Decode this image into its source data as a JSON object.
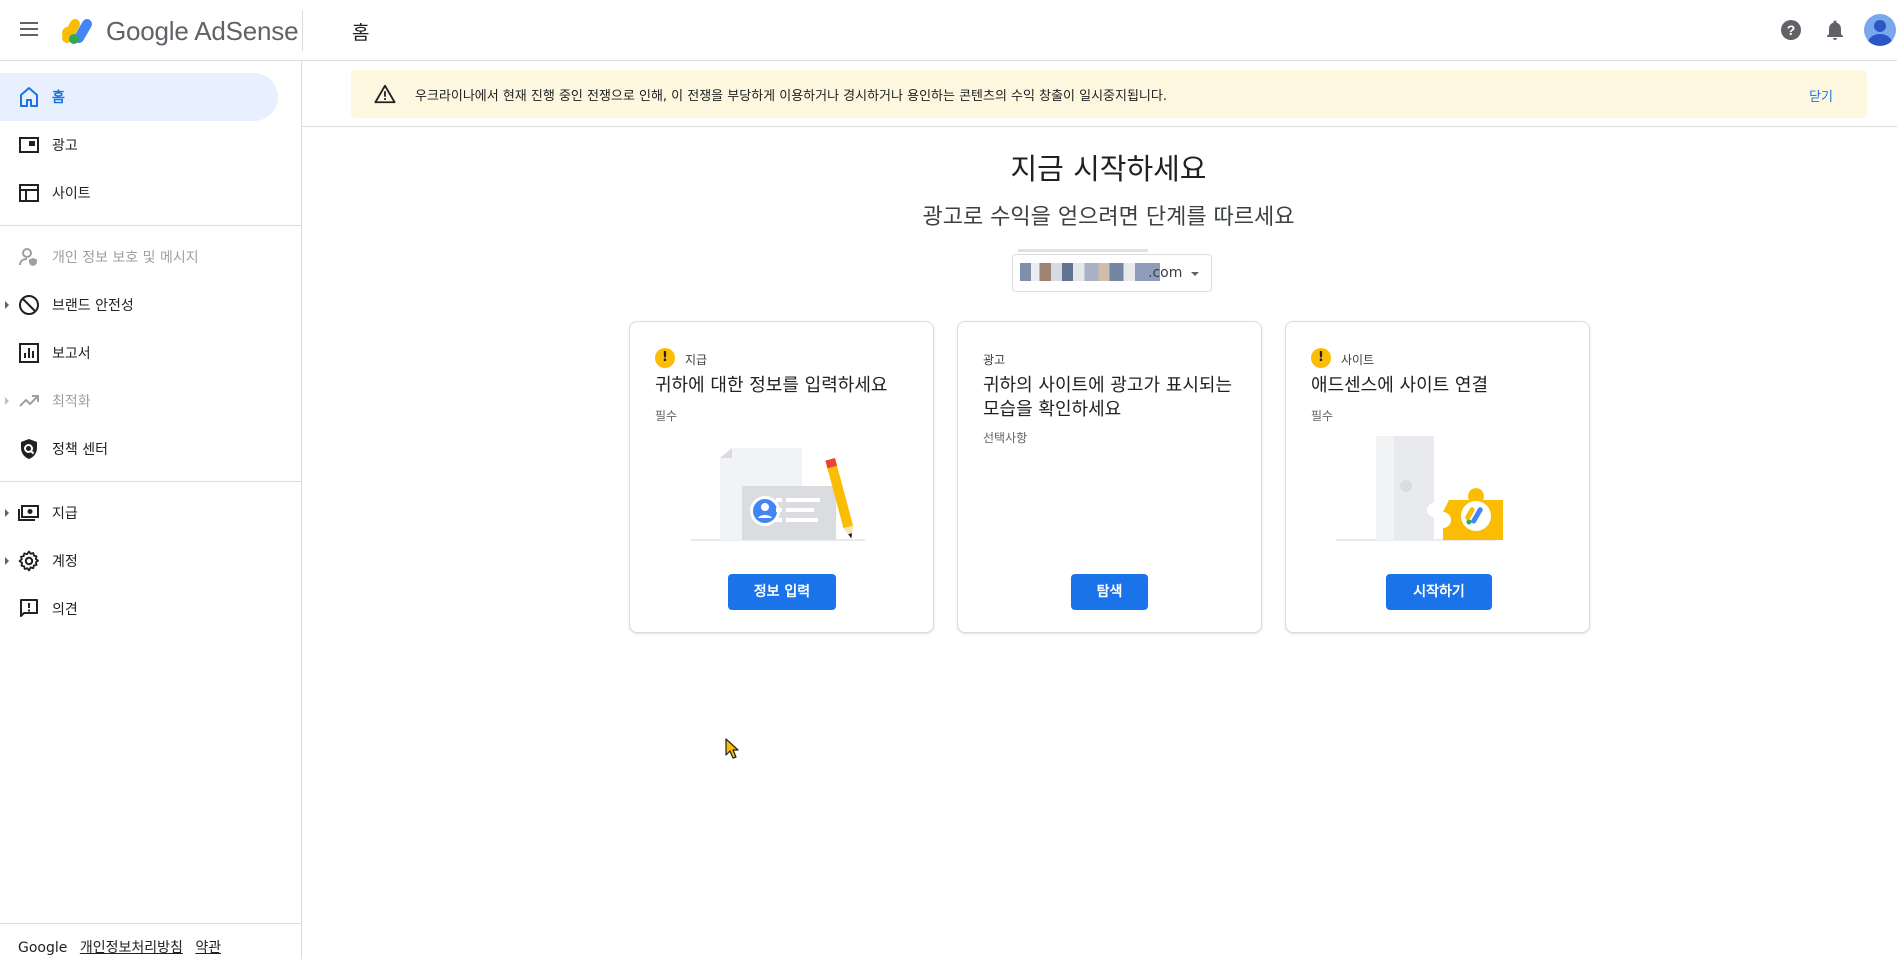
{
  "header": {
    "brand": "Google AdSense",
    "page_title": "홈"
  },
  "sidebar": {
    "items": [
      {
        "label": "홈",
        "icon": "home-icon",
        "state": "active"
      },
      {
        "label": "광고",
        "icon": "ads-icon",
        "state": "normal"
      },
      {
        "label": "사이트",
        "icon": "sites-icon",
        "state": "normal"
      },
      {
        "label": "개인 정보 보호 및 메시지",
        "icon": "privacy-icon",
        "state": "disabled"
      },
      {
        "label": "브랜드 안전성",
        "icon": "block-icon",
        "state": "normal"
      },
      {
        "label": "보고서",
        "icon": "reports-icon",
        "state": "normal"
      },
      {
        "label": "최적화",
        "icon": "trending-icon",
        "state": "disabled"
      },
      {
        "label": "정책 센터",
        "icon": "policy-icon",
        "state": "normal"
      },
      {
        "label": "지급",
        "icon": "payments-icon",
        "state": "normal"
      },
      {
        "label": "계정",
        "icon": "gear-icon",
        "state": "normal"
      },
      {
        "label": "의견",
        "icon": "feedback-icon",
        "state": "normal"
      }
    ],
    "footer": {
      "brand": "Google",
      "privacy": "개인정보처리방침",
      "terms": "약관"
    }
  },
  "banner": {
    "message": "우크라이나에서 현재 진행 중인 전쟁으로 인해, 이 전쟁을 부당하게 이용하거나 경시하거나 용인하는 콘텐츠의 수익 창출이 일시중지됩니다.",
    "close": "닫기"
  },
  "main": {
    "title": "지금 시작하세요",
    "subtitle": "광고로 수익을 얻으려면 단계를 따르세요",
    "site_select": {
      "suffix": ".com"
    },
    "cards": [
      {
        "category": "지급",
        "title": "귀하에 대한 정보를 입력하세요",
        "requirement": "필수",
        "button": "정보 입력",
        "has_warning": true
      },
      {
        "category": "광고",
        "title": "귀하의 사이트에 광고가 표시되는 모습을 확인하세요",
        "requirement": "선택사항",
        "button": "탐색",
        "has_warning": false
      },
      {
        "category": "사이트",
        "title": "애드센스에 사이트 연결",
        "requirement": "필수",
        "button": "시작하기",
        "has_warning": true
      }
    ]
  },
  "colors": {
    "accent": "#1a73e8",
    "warning": "#fbbc04",
    "banner_bg": "#fef7e0",
    "active_nav_bg": "#e8f0fe"
  }
}
